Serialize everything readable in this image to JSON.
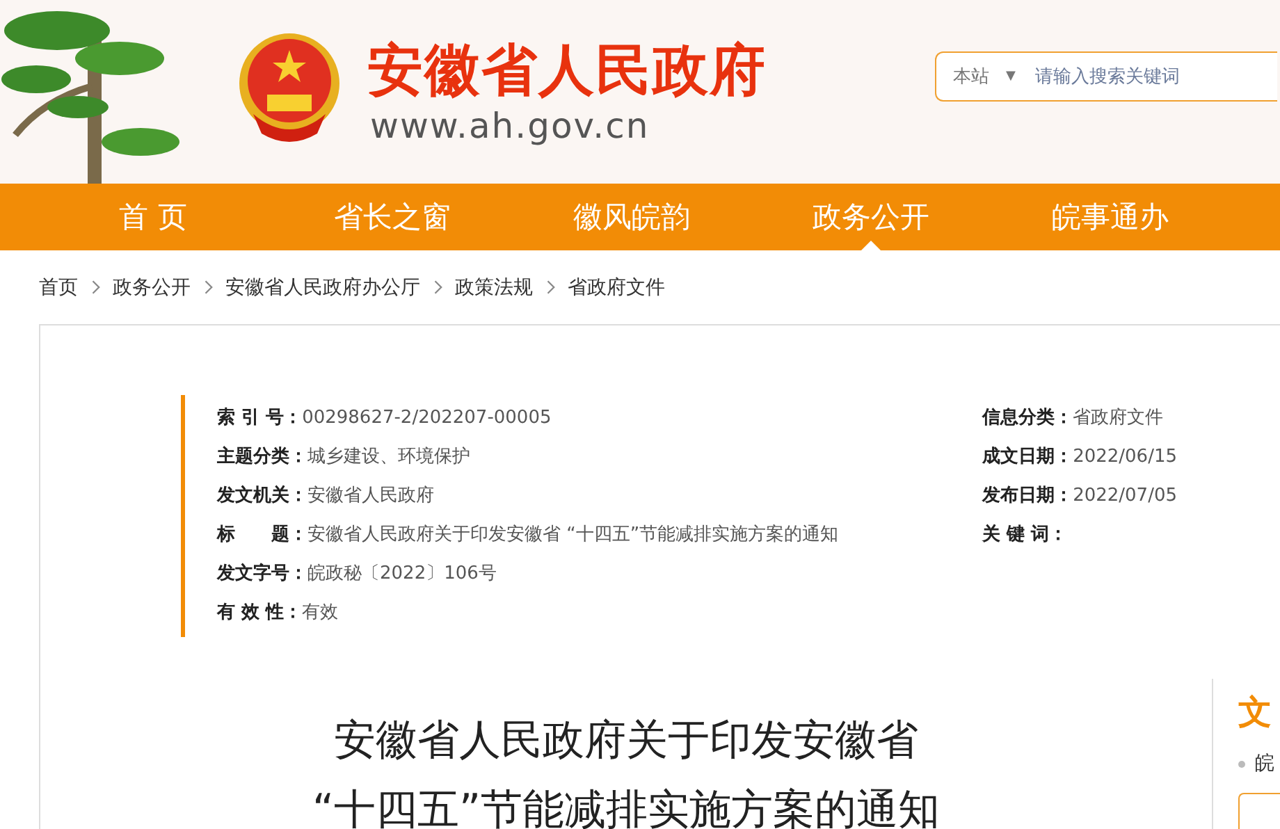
{
  "header": {
    "site_title": "安徽省人民政府",
    "site_url": "www.ah.gov.cn",
    "search": {
      "scope": "本站",
      "scope_caret": "▼",
      "placeholder": "请输入搜索关键词"
    }
  },
  "nav": [
    {
      "label": "首 页",
      "selected": false
    },
    {
      "label": "省长之窗",
      "selected": false
    },
    {
      "label": "徽风皖韵",
      "selected": false
    },
    {
      "label": "政务公开",
      "selected": true
    },
    {
      "label": "皖事通办",
      "selected": false
    }
  ],
  "breadcrumb": [
    "首页",
    "政务公开",
    "安徽省人民政府办公厅",
    "政策法规",
    "省政府文件"
  ],
  "meta": {
    "left": [
      {
        "label": "索 引 号：",
        "value": "00298627-2/202207-00005"
      },
      {
        "label": "主题分类：",
        "value": "城乡建设、环境保护"
      },
      {
        "label": "发文机关：",
        "value": "安徽省人民政府"
      },
      {
        "label": "标　　题：",
        "value": "安徽省人民政府关于印发安徽省 “十四五”节能减排实施方案的通知"
      },
      {
        "label": "发文字号：",
        "value": "皖政秘〔2022〕106号"
      },
      {
        "label": "有 效 性：",
        "value": "有效"
      }
    ],
    "right": [
      {
        "label": "信息分类：",
        "value": "省政府文件"
      },
      {
        "label": "成文日期：",
        "value": "2022/06/15"
      },
      {
        "label": "发布日期：",
        "value": "2022/07/05"
      },
      {
        "label": "关 键 词："
      }
    ]
  },
  "article_title": [
    "安徽省人民政府关于印发安徽省",
    "“十四五”节能减排实施方案的通知"
  ],
  "sidebar": {
    "heading": "文",
    "items": [
      "皖"
    ]
  }
}
